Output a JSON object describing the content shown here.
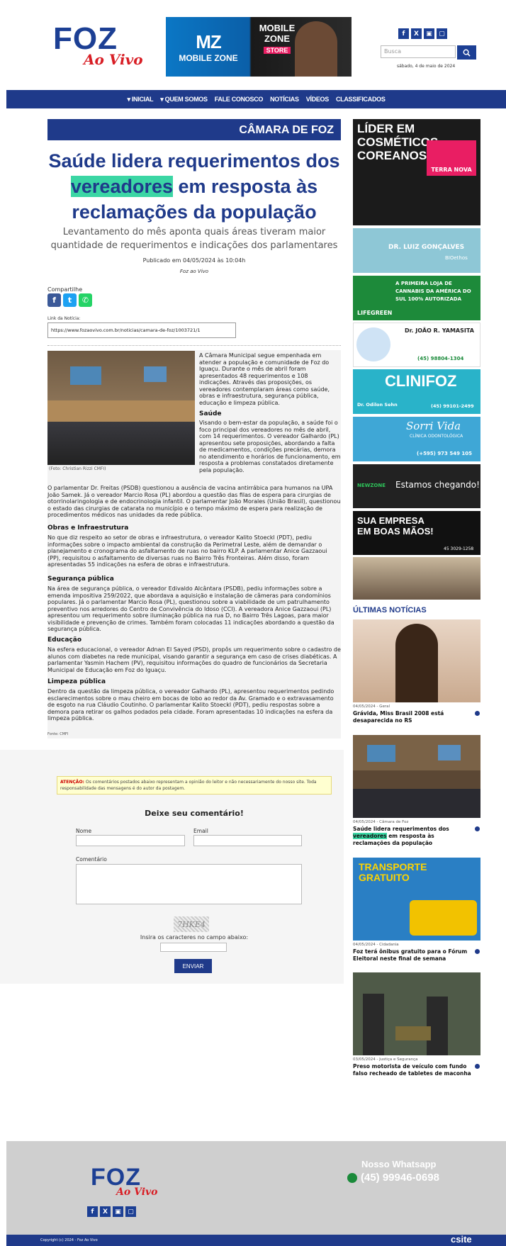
{
  "header": {
    "logo_main": "FOZ",
    "logo_sub": "Ao Vivo",
    "banner": {
      "brand_left_big": "MZ",
      "brand_left": "MOBILE ZONE",
      "brand_right": "MOBILE ZONE",
      "brand_right_sub": "STORE"
    },
    "social": [
      "f",
      "X",
      "▣",
      "▢"
    ],
    "search_placeholder": "Busca",
    "search_icon": "search-icon",
    "date": "sábado, 4 de maio de 2024"
  },
  "nav": {
    "items": [
      "▾ INICIAL",
      "▾ QUEM SOMOS",
      "FALE CONOSCO",
      "NOTÍCIAS",
      "VÍDEOS",
      "CLASSIFICADOS"
    ]
  },
  "article": {
    "section": "CÂMARA DE FOZ",
    "title_parts": [
      "Saúde lidera requerimentos dos",
      "vereadores",
      " em resposta às reclamações da população"
    ],
    "subtitle": "Levantamento do mês aponta quais áreas tiveram maior quantidade de requerimentos e indicações dos parlamentares",
    "published": "Publicado em 04/05/2024 às 10:04h",
    "by": "Foz ao Vivo",
    "share_label": "Compartilhe",
    "link_label": "Link da Notícia:",
    "link_value": "https://www.fozaovivo.com.br/noticias/camara-de-foz/1003721/1",
    "photo_caption": "(Foto: Christian Rizzi CMFI)",
    "intro": "A Câmara Municipal segue empenhada em atender a população e comunidade de Foz do Iguaçu. Durante o mês de abril foram apresentados 48 requerimentos e 108 indicações. Através das proposições, os vereadores contemplaram áreas como saúde, obras e infraestrutura, segurança pública, educação e limpeza pública.",
    "saude_title": "Saúde",
    "saude_text": "Visando o bem-estar da população, a saúde foi o foco principal dos vereadores no mês de abril, com 14 requerimentos. O vereador Galhardo (PL) apresentou sete proposições, abordando a falta de medicamentos, condições precárias, demora no atendimento e horários de funcionamento, em resposta a problemas constatados diretamente pela população.",
    "saude_text2": "O parlamentar Dr. Freitas (PSDB) questionou a ausência de vacina antirrábica para humanos na UPA João Samek. Já o vereador Marcio Rosa (PL) abordou a questão das filas de espera para cirurgias de otorrinolaringologia e de endocrinologia infantil. O parlamentar João Morales (União Brasil), questionou o estado das cirurgias de catarata no município e o tempo máximo de espera para realização de procedimentos médicos nas unidades da rede pública.",
    "obras_title": "Obras e Infraestrutura",
    "obras_text": "No que diz respeito ao setor de obras e infraestrutura, o vereador Kalito Stoeckl (PDT), pediu informações sobre o impacto ambiental da construção da Perimetral Leste, além de demandar o planejamento e cronograma do asfaltamento de ruas no bairro KLP. A parlamentar Anice Gazzaoui (PP), requisitou o asfaltamento de diversas ruas no Bairro Três Fronteiras. Além disso, foram apresentadas 55 indicações na esfera de obras e infraestrutura.",
    "seg_title": "Segurança pública",
    "seg_text": "Na área de segurança pública, o vereador Edivaldo Alcântara (PSDB), pediu informações sobre a emenda impositiva 259/2022, que abordava a aquisição e instalação de câmeras para condomínios populares. Já o parlamentar Marcio Rosa (PL), questionou sobre a viabilidade de um patrulhamento preventivo nos arredores do Centro de Convivência do Idoso (CCI). A vereadora Anice Gazzaoui (PL) apresentou um requerimento sobre iluminação pública na rua D, no Bairro Três Lagoas, para maior visibilidade e prevenção de crimes. Também foram colocadas 11 indicações abordando a questão da segurança pública.",
    "edu_title": "Educação",
    "edu_text": "Na esfera educacional, o vereador Adnan El Sayed (PSD), propôs um requerimento sobre o cadastro de alunos com diabetes na rede municipal, visando garantir a segurança em caso de crises diabéticas. A parlamentar Yasmin Hachem (PV), requisitou informações do quadro de funcionários da Secretaria Municipal de Educação em Foz do Iguaçu.",
    "limp_title": "Limpeza pública",
    "limp_text": "Dentro da questão da limpeza pública, o vereador Galhardo (PL), apresentou requerimentos pedindo esclarecimentos sobre o mau cheiro em bocas de lobo ao redor da Av. Gramado e o extravasamento de esgoto na rua Cláudio Coutinho. O parlamentar Kalito Stoeckl (PDT), pediu respostas sobre a demora para retirar os galhos podados pela cidade. Foram apresentadas 10 indicações na esfera da limpeza pública.",
    "source": "Fonte: CMFI"
  },
  "sidebar": {
    "ads": [
      {
        "title": "LÍDER EM COSMÉTICOS COREANOS",
        "brand": "TERRA NOVA"
      },
      {
        "title": "DR. LUIZ GONÇALVES",
        "brand": "BIOethos"
      },
      {
        "title": "A PRIMEIRA LOJA DE CANNABIS DA AMÉRICA DO SUL 100% AUTORIZADA",
        "brand": "LIFEGREEN"
      },
      {
        "title": "Dr. JOÃO R. YAMASITA",
        "phone": "(45) 98804-1304"
      },
      {
        "title": "CLINIFOZ",
        "brand": "Dr. Odilon Sehn",
        "phone": "(45) 99101-2499"
      },
      {
        "title": "Sorri Vida",
        "brand": "CLÍNICA ODONTOLÓGICA",
        "phone": "(+595) 973 549 105"
      },
      {
        "title": "Estamos chegando!",
        "brand": "NEWZONE"
      },
      {
        "title": "SUA EMPRESA EM BOAS MÃOS!",
        "phone": "45 3029-1258"
      },
      {
        "title": ""
      }
    ],
    "latest_title": "ÚLTIMAS NOTÍCIAS",
    "news": [
      {
        "meta": "04/05/2024 - Geral",
        "title": "Grávida, Miss Brasil 2008 está desaparecida no RS"
      },
      {
        "meta": "04/05/2024 - Câmara de Foz",
        "title_parts": [
          "Saúde lidera requerimentos dos ",
          "vereadores",
          " em resposta às reclamações da população"
        ]
      },
      {
        "meta": "04/05/2024 - Cidadania",
        "title": "Foz terá ônibus gratuito para o Fórum Eleitoral neste final de semana",
        "img_title": "TRANSPORTE GRATUITO"
      },
      {
        "meta": "03/05/2024 - Justiça e Segurança",
        "title": "Preso motorista de veículo com fundo falso recheado de tabletes de maconha"
      }
    ]
  },
  "comments": {
    "warning_label": "ATENÇÃO:",
    "warning_text": "Os comentários postados abaixo representam a opinião do leitor e não necessariamente do nosso site. Toda responsabilidade das mensagens é do autor da postagem.",
    "title": "Deixe seu comentário!",
    "name_label": "Nome",
    "email_label": "Email",
    "comment_label": "Comentário",
    "captcha_text": "7HKE4",
    "captcha_label": "Insira os caracteres no campo abaixo:",
    "send_label": "ENVIAR"
  },
  "footer": {
    "whatsapp_label": "Nosso Whatsapp",
    "whatsapp_number": "(45) 99946-0698",
    "copyright": "Copyright (c) 2024 - Foz Ao Vivo",
    "brand": "csite"
  },
  "colors": {
    "primary": "#1f3a8a",
    "highlight": "#3bd6a4",
    "logo_red": "#d81e25"
  }
}
